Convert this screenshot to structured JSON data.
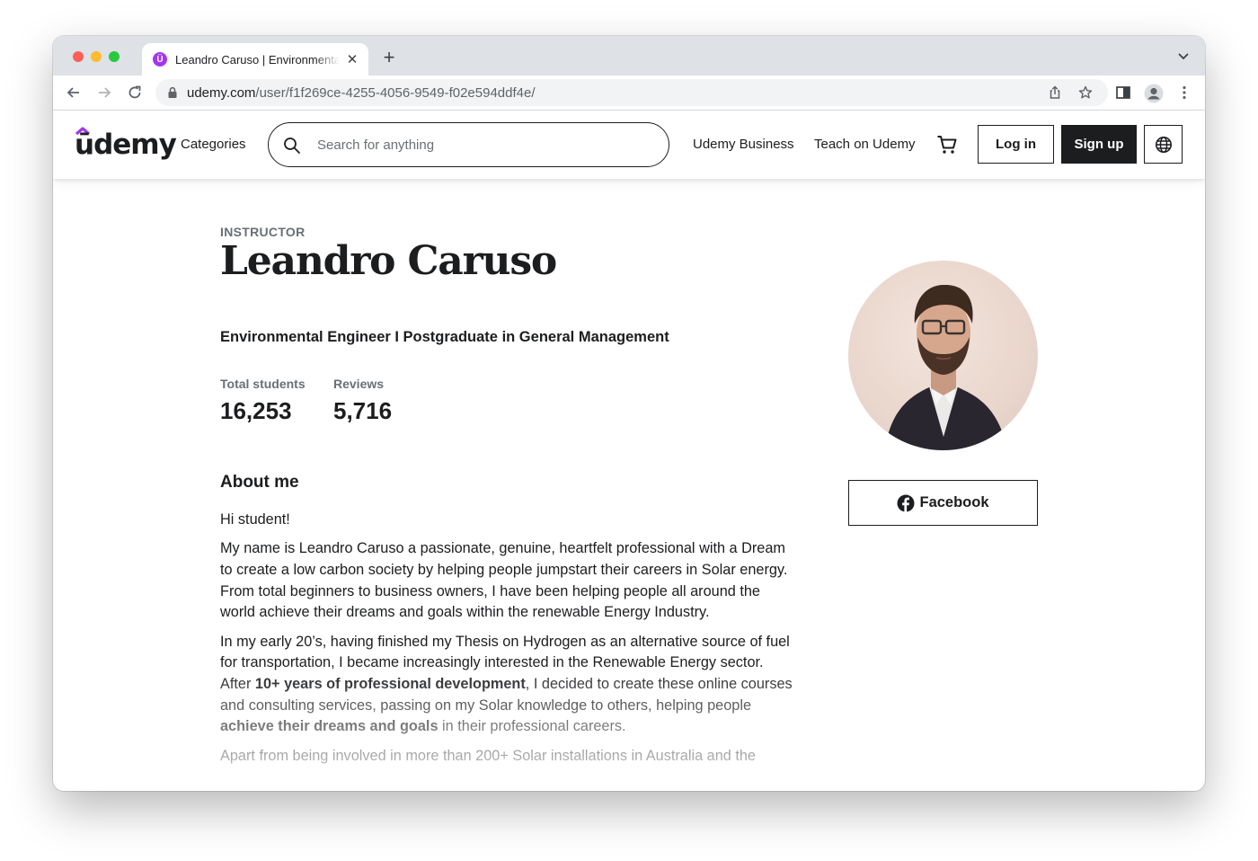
{
  "browser": {
    "tab_title": "Leandro Caruso | Environmental Engineer",
    "tab_favicon_letter": "Ü",
    "url_host": "udemy.com",
    "url_path": "/user/f1f269ce-4255-4056-9549-f02e594ddf4e/"
  },
  "header": {
    "logo_text": "ūdemy",
    "categories": "Categories",
    "search_placeholder": "Search for anything",
    "udemy_business": "Udemy Business",
    "teach": "Teach on Udemy",
    "login": "Log in",
    "signup": "Sign up"
  },
  "profile": {
    "eyebrow": "INSTRUCTOR",
    "name": "Leandro Caruso",
    "headline": "Environmental Engineer I Postgraduate in General Management",
    "stats": [
      {
        "label": "Total students",
        "value": "16,253"
      },
      {
        "label": "Reviews",
        "value": "5,716"
      }
    ],
    "about_heading": "About me",
    "bio": {
      "p1": "Hi student!",
      "p2": "My name is Leandro Caruso a passionate, genuine, heartfelt professional with a Dream to create a low carbon society by helping people jumpstart their careers in Solar energy.  From total beginners to business owners, I have been helping people all around the world achieve their dreams and goals within the renewable Energy Industry.",
      "p3_a": "In my early 20’s, having finished my Thesis on Hydrogen as an alternative source of fuel for transportation, I became increasingly interested in the Renewable Energy sector. After ",
      "p3_b": "10+ years of professional development",
      "p3_c": ", I decided to create these online courses and consulting services, passing on my Solar knowledge to others, helping people ",
      "p3_d": "achieve their dreams and goals",
      "p3_e": " in their professional careers.",
      "p4": "Apart from being involved in more than 200+ Solar installations in Australia and the"
    },
    "facebook_label": "Facebook"
  },
  "colors": {
    "brand_purple": "#a435f0",
    "text": "#1c1d1f",
    "muted": "#6a6f73"
  }
}
